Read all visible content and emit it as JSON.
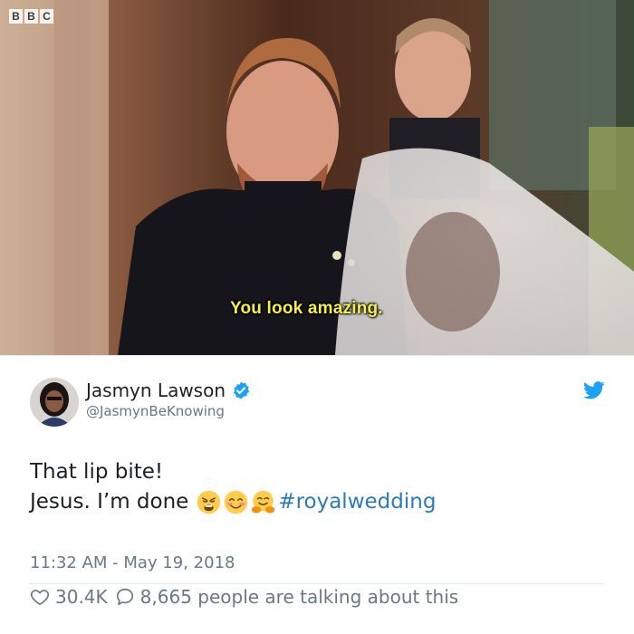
{
  "media": {
    "broadcaster_logo": [
      "B",
      "B",
      "C"
    ],
    "caption": "You look amazing."
  },
  "tweet": {
    "author": {
      "display_name": "Jasmyn Lawson",
      "handle": "@JasmynBeKnowing",
      "verified": true
    },
    "text_line1": "That lip bite!",
    "text_line2": "Jesus. I’m done",
    "emojis": [
      "weary-face-emoji",
      "smiling-face-emoji",
      "hugging-face-emoji"
    ],
    "hashtag": "#royalwedding",
    "timestamp": "11:32 AM - May 19, 2018",
    "like_count": "30.4K",
    "reply_summary": "8,665 people are talking about this"
  },
  "colors": {
    "link": "#2b7bb9",
    "twitter_blue": "#1da1f2",
    "caption_yellow": "#f4ef4a",
    "secondary_text": "#697882"
  }
}
